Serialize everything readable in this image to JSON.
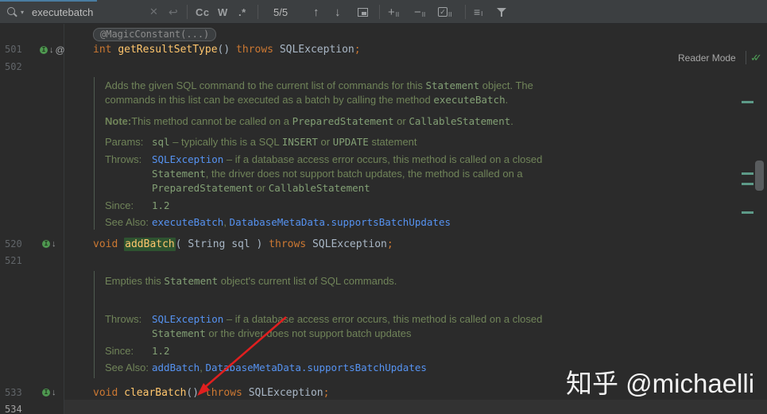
{
  "find_bar": {
    "query": "executebatch",
    "count": "5/5",
    "icons": {
      "search": "magnifier-css-shape",
      "search_caret": "▾",
      "close": "✕",
      "newline": "↩",
      "match_case": "Cc",
      "words": "W",
      "regex": ".*",
      "prev": "↑",
      "next": "↓",
      "in_selection": "square-with-corner-css-shape",
      "add_occurrence": "+",
      "remove_occurrence": "−",
      "occurrence_sub": "II",
      "select_all_check": "✓",
      "search_options": "≡",
      "search_options_sub": "I",
      "filter": "funnel-css-shape"
    }
  },
  "editor": {
    "reader_mode_label": "Reader Mode",
    "inspection_check": "✓",
    "gutter": {
      "n501": "501",
      "n502": "502",
      "n520": "520",
      "n521": "521",
      "n533": "533",
      "n534": "534",
      "impl_glyph": "I",
      "down_arrow": "↓",
      "annotation_at": "@"
    },
    "annotation_pill": "@MagicConstant(...)",
    "line501": {
      "kw1": "int ",
      "name": "getResultSetType",
      "p1": "() ",
      "kw2": "throws ",
      "t1": "SQLException",
      "semi": ";"
    },
    "line520": {
      "kw1": "void ",
      "name": "addBatch",
      "p1": "( ",
      "t1": "String sql ) ",
      "kw2": "throws ",
      "t2": "SQLException",
      "semi": ";"
    },
    "line533": {
      "kw1": "void ",
      "name": "clearBatch",
      "p1": "() ",
      "kw2": "throws ",
      "t1": "SQLException",
      "semi": ";"
    },
    "doc1": {
      "p1": {
        "t1": "Adds the given SQL command to the current list of commands for this ",
        "c1": "Statement",
        "t2": " object. The commands in this list can be executed as a batch by calling the method ",
        "c2": "executeBatch",
        "t3": "."
      },
      "note": {
        "b": "Note:",
        "t1": "This method cannot be called on a ",
        "c1": "PreparedStatement",
        "t2": " or ",
        "c2": "CallableStatement",
        "t3": "."
      },
      "params_label": "Params:",
      "params": {
        "c1": "sql",
        "t1": " – typically this is a SQL ",
        "c2": "INSERT",
        "t2": " or ",
        "c3": "UPDATE",
        "t3": " statement"
      },
      "throws_label": "Throws:",
      "throws": {
        "l1": "SQLException",
        "t1": " – if a database access error occurs, this method is called on a closed ",
        "c1": "Statement",
        "t2": ", the driver does not support batch updates, the method is called on a ",
        "c2": "PreparedStatement",
        "t3": " or ",
        "c3": "CallableStatement"
      },
      "since_label": "Since:",
      "since": "1.2",
      "seealso_label": "See Also:",
      "seealso": {
        "l1": "executeBatch",
        "t1": ", ",
        "l2": "DatabaseMetaData.supportsBatchUpdates"
      }
    },
    "doc2": {
      "p1": {
        "t1": "Empties this ",
        "c1": "Statement",
        "t2": " object's current list of SQL commands."
      },
      "throws_label": "Throws:",
      "throws": {
        "l1": "SQLException",
        "t1": " – if a database access error occurs, this method is called on a closed ",
        "c1": "Statement",
        "t2": " or the driver does not support batch updates"
      },
      "since_label": "Since:",
      "since": "1.2",
      "seealso_label": "See Also:",
      "seealso": {
        "l1": "addBatch",
        "t1": ", ",
        "l2": "DatabaseMetaData.supportsBatchUpdates"
      }
    }
  },
  "watermark": "知乎 @michaelli",
  "colors": {
    "toolbar_bg": "#3c3f41",
    "editor_bg": "#2b2b2b",
    "tab_accent": "#4a7da1",
    "keyword": "#cc7832",
    "method": "#ffc66d",
    "doc_text": "#708459",
    "doc_link": "#5693f2",
    "search_highlight_bg": "#2e5330",
    "arrow_red": "#e01f1f",
    "marker_green": "#4e9850"
  }
}
